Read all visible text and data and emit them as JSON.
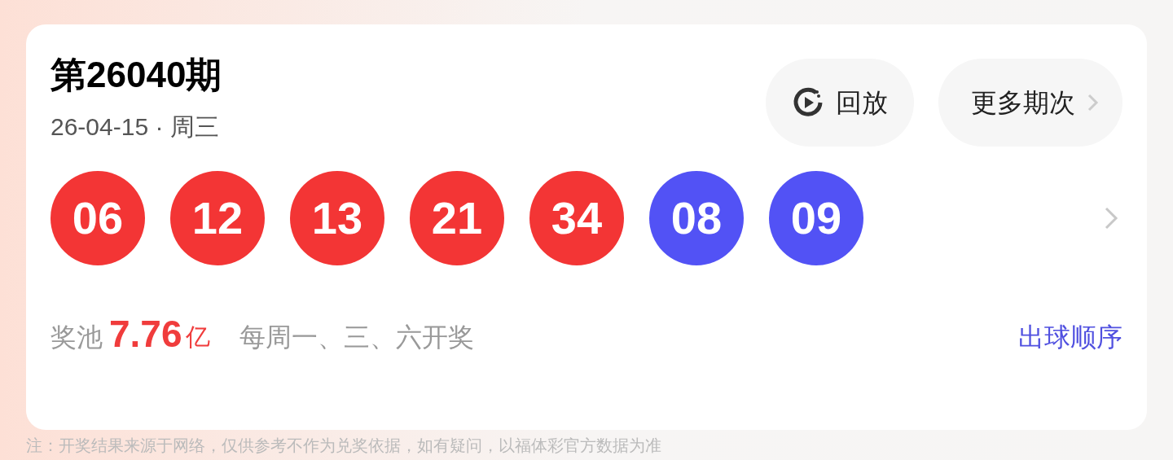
{
  "draw": {
    "title": "第26040期",
    "date": "26-04-15 · 周三"
  },
  "buttons": [
    {
      "kind": "replay",
      "label": "回放"
    },
    {
      "kind": "more",
      "label": "更多期次"
    }
  ],
  "balls": [
    {
      "number": "06",
      "color": "#f33535"
    },
    {
      "number": "12",
      "color": "#f33535"
    },
    {
      "number": "13",
      "color": "#f33535"
    },
    {
      "number": "21",
      "color": "#f33535"
    },
    {
      "number": "34",
      "color": "#f33535"
    },
    {
      "number": "08",
      "color": "#5252f5"
    },
    {
      "number": "09",
      "color": "#5252f5"
    }
  ],
  "pool": {
    "label": "奖池",
    "amount": "7.76",
    "unit": "亿",
    "schedule": "每周一、三、六开奖"
  },
  "order_link": "出球顺序",
  "note": "注：开奖结果来源于网络，仅供参考不作为兑奖依据，如有疑问，以福体彩官方数据为准"
}
